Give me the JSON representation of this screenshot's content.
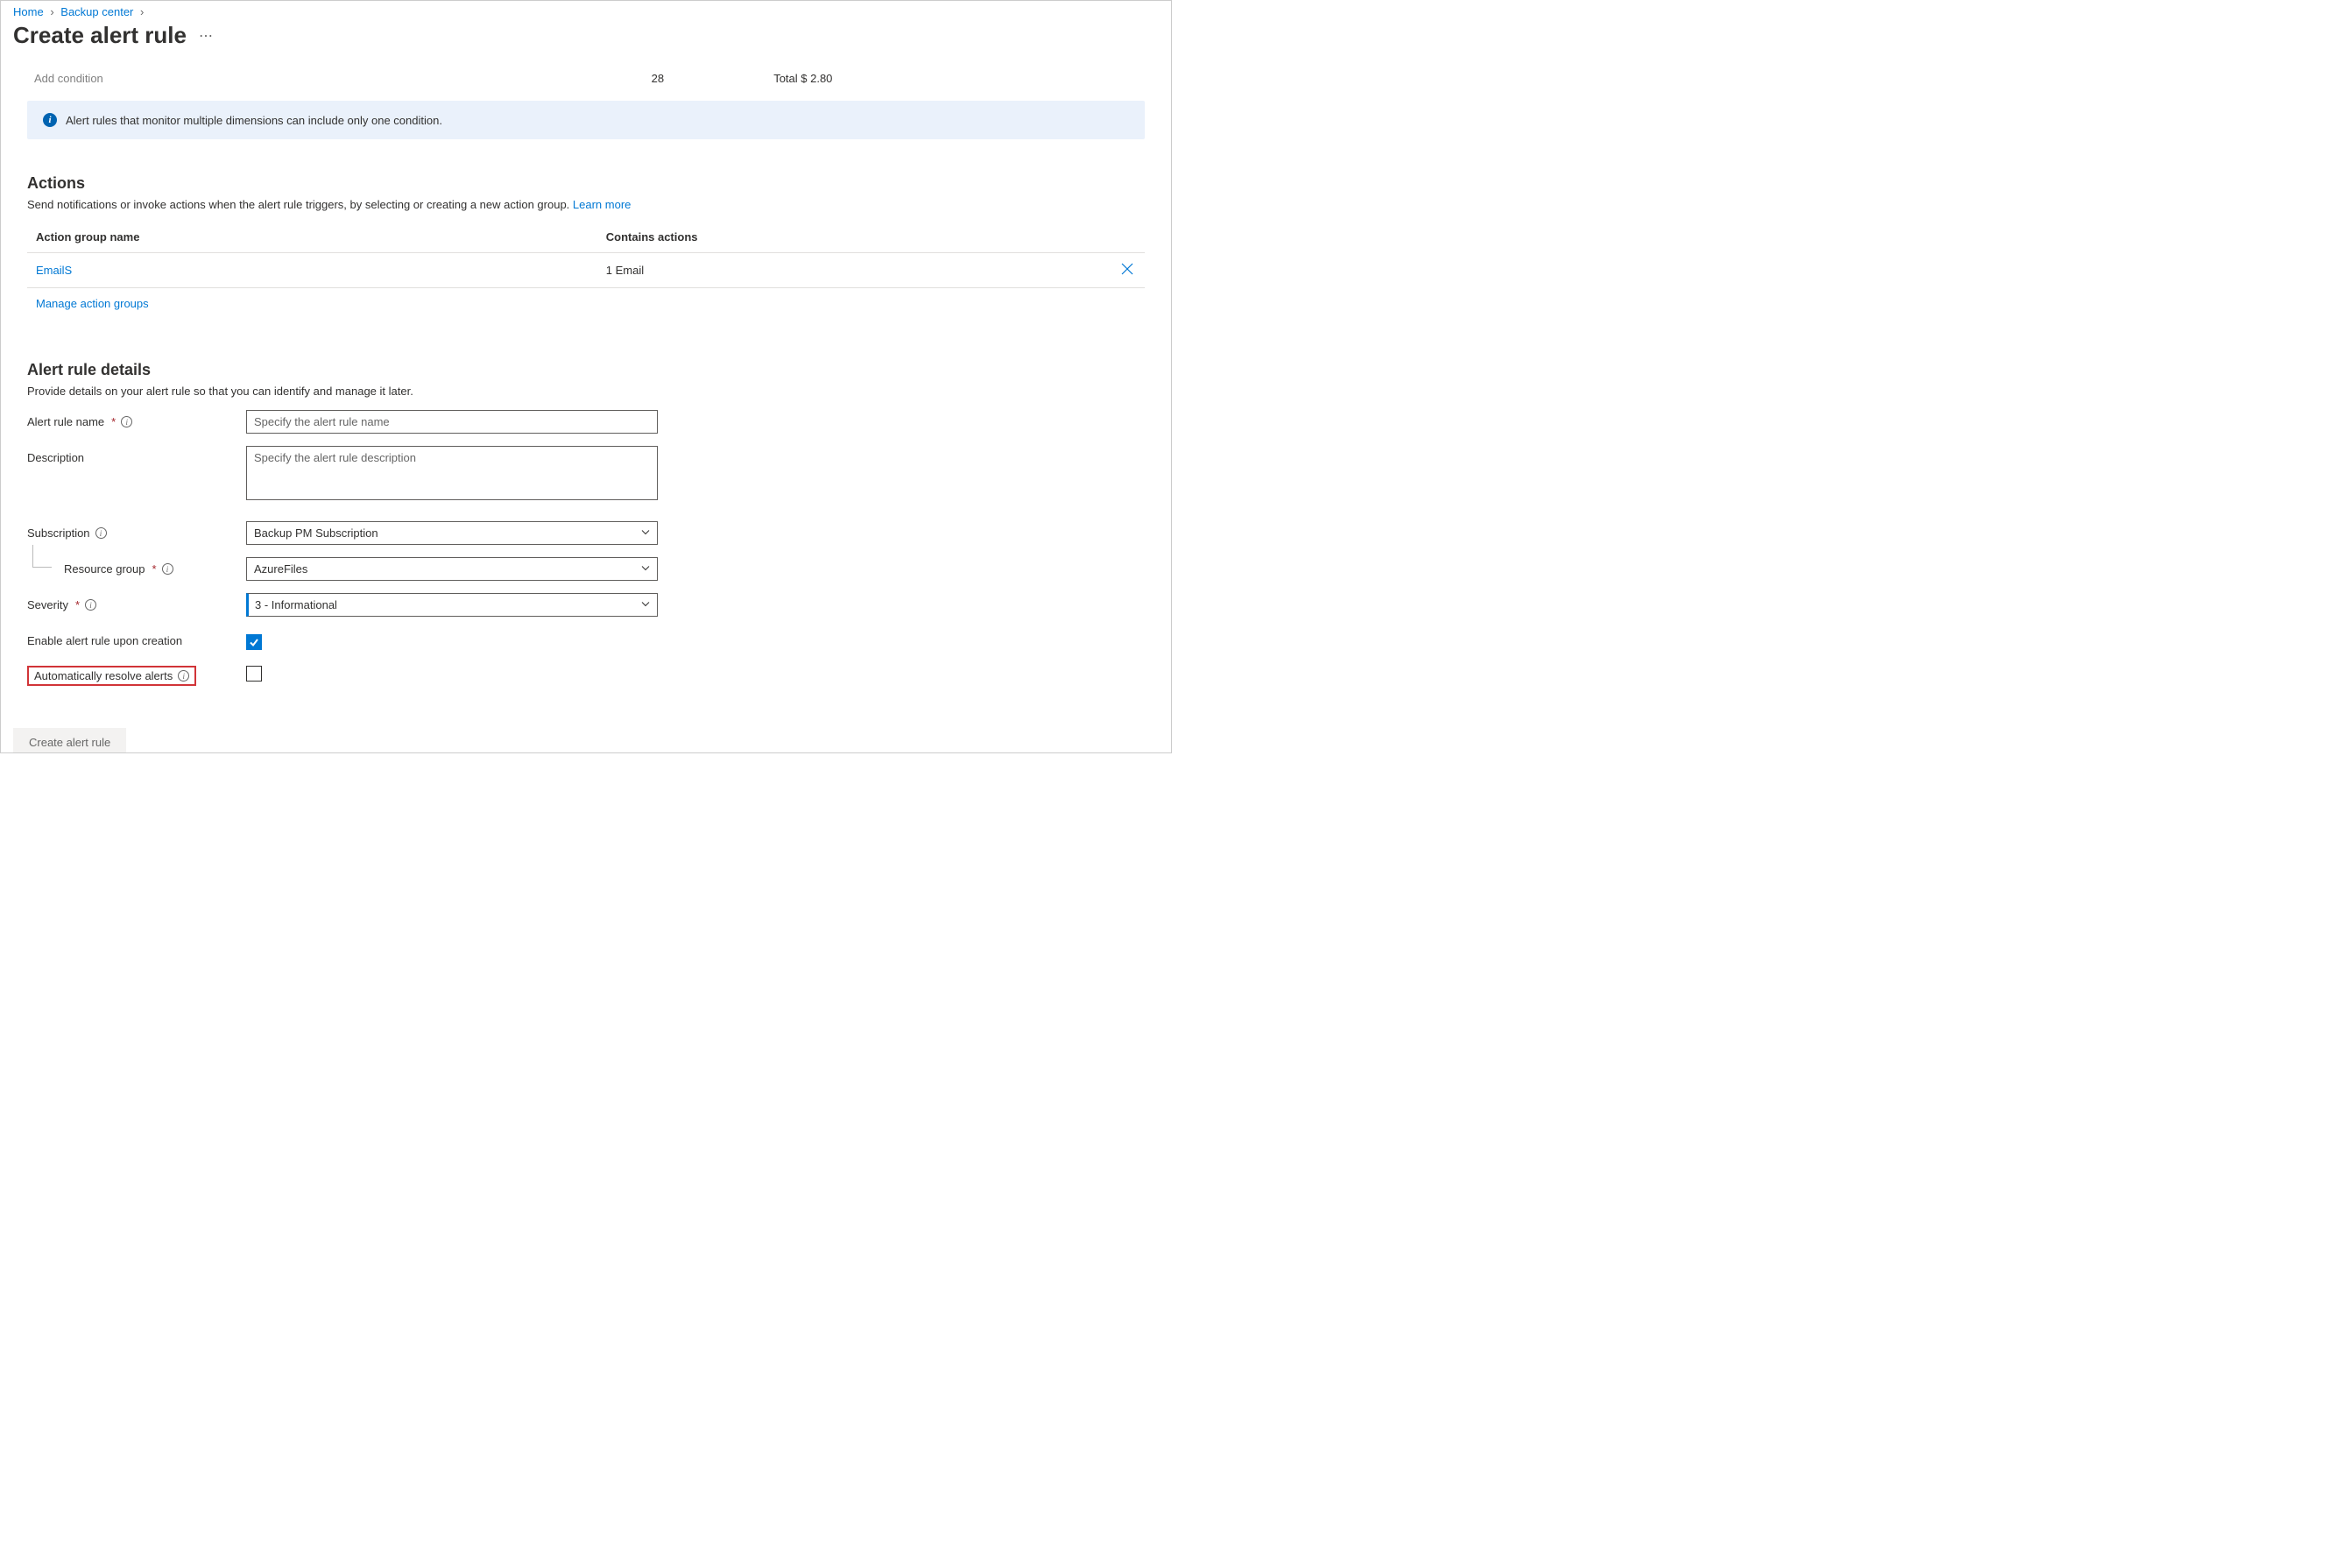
{
  "breadcrumb": {
    "home": "Home",
    "backup_center": "Backup center"
  },
  "page_title": "Create alert rule",
  "condition": {
    "add_label": "Add condition",
    "count": "28",
    "total": "Total $ 2.80"
  },
  "info_banner": "Alert rules that monitor multiple dimensions can include only one condition.",
  "actions": {
    "heading": "Actions",
    "desc": "Send notifications or invoke actions when the alert rule triggers, by selecting or creating a new action group. ",
    "learn_more": "Learn more",
    "col_name": "Action group name",
    "col_contains": "Contains actions",
    "rows": [
      {
        "name": "EmailS",
        "contains": "1 Email"
      }
    ],
    "manage": "Manage action groups"
  },
  "details": {
    "heading": "Alert rule details",
    "desc": "Provide details on your alert rule so that you can identify and manage it later.",
    "name_label": "Alert rule name",
    "name_placeholder": "Specify the alert rule name",
    "desc_label": "Description",
    "desc_placeholder": "Specify the alert rule description",
    "subscription_label": "Subscription",
    "subscription_value": "Backup PM Subscription",
    "rg_label": "Resource group",
    "rg_value": "AzureFiles",
    "severity_label": "Severity",
    "severity_value": "3 - Informational",
    "enable_label": "Enable alert rule upon creation",
    "auto_resolve_label": "Automatically resolve alerts"
  },
  "footer": {
    "create": "Create alert rule"
  }
}
